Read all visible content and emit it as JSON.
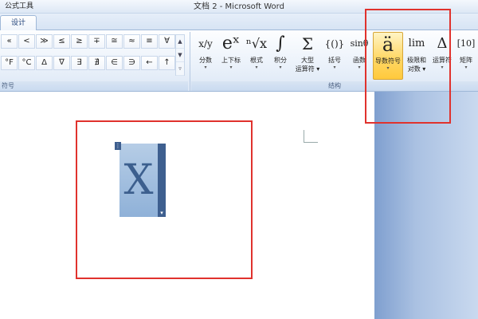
{
  "titlebar": {
    "context_tab": "公式工具",
    "title": "文档 2 - Microsoft Word"
  },
  "tabs": {
    "active": "设计"
  },
  "ribbon": {
    "symbols_group_label": "符号",
    "structures_group_label": "结构",
    "symbols": [
      "«",
      "<",
      "≫",
      "≤",
      "≥",
      "∓",
      "≅",
      "≈",
      "≡",
      "∀",
      "°F",
      "°C",
      "Δ",
      "∇",
      "∃",
      "∄",
      "∈",
      "∋",
      "←",
      "↑"
    ],
    "scroll": [
      "▲",
      "▼",
      "▿"
    ],
    "tools": [
      {
        "icon": "x/y",
        "label": "分数",
        "label2": "",
        "dd": "▾"
      },
      {
        "icon": "eˣ",
        "label": "上下标",
        "label2": "",
        "dd": "▾"
      },
      {
        "icon": "ⁿ√x",
        "label": "根式",
        "label2": "",
        "dd": "▾"
      },
      {
        "icon": "∫",
        "label": "积分",
        "label2": "",
        "dd": "▾"
      },
      {
        "icon": "Σ",
        "label": "大型",
        "label2": "运算符 ▾",
        "dd": ""
      },
      {
        "icon": "{()}",
        "label": "括号",
        "label2": "",
        "dd": "▾"
      },
      {
        "icon": "sinθ",
        "label": "函数",
        "label2": "",
        "dd": "▾"
      },
      {
        "icon": "ä",
        "label": "导数符号",
        "label2": "",
        "dd": "▾"
      },
      {
        "icon": "lim",
        "label": "极限和",
        "label2": "对数 ▾",
        "dd": ""
      },
      {
        "icon": "Δ",
        "label": "运算符",
        "label2": "",
        "dd": "▾"
      },
      {
        "icon": "[10]",
        "label": "矩阵",
        "label2": "",
        "dd": "▾"
      }
    ]
  },
  "equation": {
    "text": "X",
    "handle": "⋮",
    "arrow": "▾"
  }
}
